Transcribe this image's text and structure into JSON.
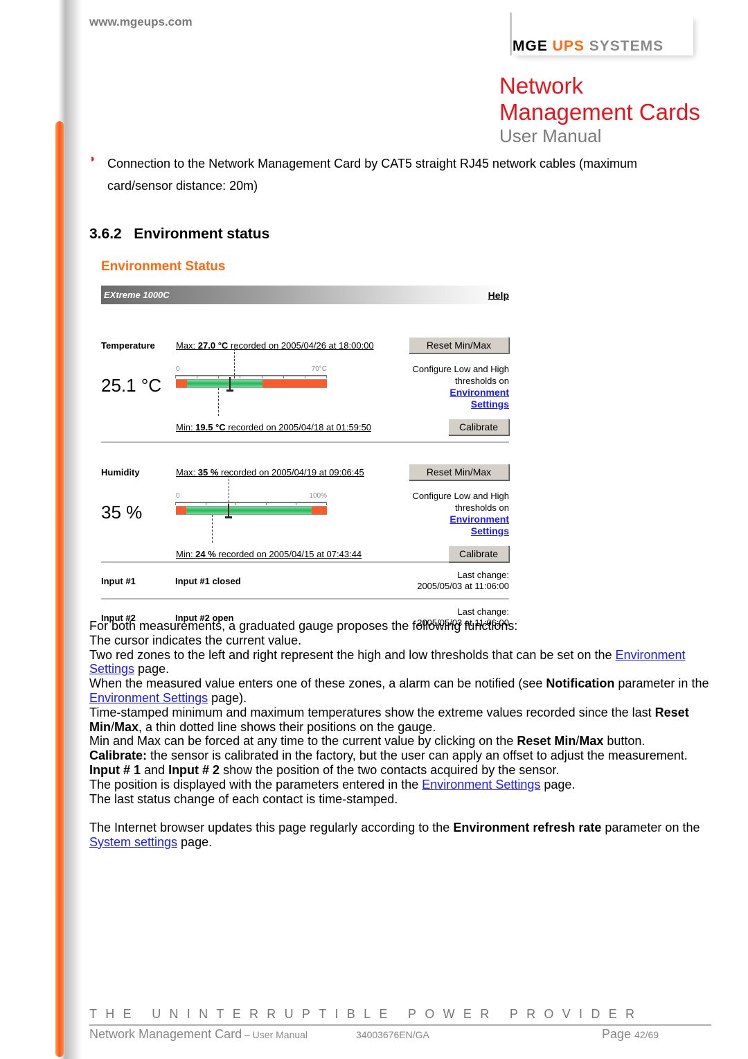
{
  "header": {
    "url": "www.mgeups.com",
    "logo": {
      "mge": "MGE",
      "ups": "UPS",
      "systems": "SYSTEMS"
    },
    "title_line1": "Network",
    "title_line2": "Management Cards",
    "subtitle": "User Manual"
  },
  "bullet": "Connection to the Network Management Card by CAT5 straight RJ45 network cables (maximum card/sensor distance: 20m)",
  "section": {
    "number": "3.6.2",
    "title": "Environment status"
  },
  "panel": {
    "title": "Environment Status",
    "device": "EXtreme 1000C",
    "help": "Help",
    "colors": {
      "zone_red": "#ff5a2a",
      "zone_green": "#33cc66",
      "link": "#1a1aff",
      "accent": "#ff6a10"
    },
    "measurements": [
      {
        "label": "Temperature",
        "value": "25.1 °C",
        "current": 25.1,
        "max_prefix": "Max: ",
        "max_value": "27.0 °C",
        "max_suffix": " recorded on 2005/04/26 at 18:00:00",
        "max": 27.0,
        "min_prefix": "Min: ",
        "min_value": "19.5 °C",
        "min_suffix": " recorded on 2005/04/18 at 01:59:50",
        "min": 19.5,
        "scale_min_label": "0",
        "scale_max_label": "70°C",
        "range": [
          0,
          70
        ],
        "tick_step": 10,
        "low_threshold": 5,
        "high_threshold": 40,
        "reset": "Reset Min/Max",
        "cfg1": "Configure Low and High",
        "cfg2": "thresholds on",
        "link1": "Environment",
        "link2": "Settings",
        "calibrate": "Calibrate"
      },
      {
        "label": "Humidity",
        "value": "35 %",
        "current": 35,
        "max_prefix": "Max: ",
        "max_value": "35 %",
        "max_suffix": " recorded on 2005/04/19 at 09:06:45",
        "max": 35,
        "min_prefix": "Min: ",
        "min_value": "24 %",
        "min_suffix": " recorded on 2005/04/15 at 07:43:44",
        "min": 24,
        "scale_min_label": "0",
        "scale_max_label": "100%",
        "range": [
          0,
          100
        ],
        "tick_step": 20,
        "low_threshold": 7,
        "high_threshold": 90,
        "reset": "Reset Min/Max",
        "cfg1": "Configure Low and High",
        "cfg2": "thresholds on",
        "link1": "Environment",
        "link2": "Settings",
        "calibrate": "Calibrate"
      }
    ],
    "inputs": [
      {
        "label": "Input #1",
        "state": "Input #1 closed",
        "change_label": "Last change:",
        "change_time": "2005/05/03 at 11:06:00"
      },
      {
        "label": "Input #2",
        "state": "Input #2 open",
        "change_label": "Last change:",
        "change_time": "2005/05/03 at 11:06:00"
      }
    ]
  },
  "body": [
    [
      {
        "t": "For both measurements, a graduated gauge proposes the following functions:"
      }
    ],
    [
      {
        "t": "The cursor indicates the current value."
      }
    ],
    [
      {
        "t": "Two red zones to the left and right represent the high and low thresholds that can be set on the "
      },
      {
        "t": "Environment Settings",
        "link": true
      },
      {
        "t": " page."
      }
    ],
    [
      {
        "t": "When the measured value enters one of these zones, a alarm can be notified (see "
      },
      {
        "t": "Notification",
        "b": true
      },
      {
        "t": " parameter in the "
      },
      {
        "t": "Environment Settings",
        "link": true
      },
      {
        "t": " page)."
      }
    ],
    [
      {
        "t": "Time-stamped minimum and maximum temperatures show the extreme values recorded since the last "
      },
      {
        "t": "Reset Min",
        "b": true
      },
      {
        "t": "/"
      },
      {
        "t": "Max",
        "b": true
      },
      {
        "t": ", a thin dotted line shows their positions on the gauge."
      }
    ],
    [
      {
        "t": " Min and Max can be forced at any time to the current value by clicking on the "
      },
      {
        "t": "Reset Min",
        "b": true
      },
      {
        "t": "/"
      },
      {
        "t": "Max",
        "b": true
      },
      {
        "t": " button."
      }
    ],
    [
      {
        "t": "Calibrate:",
        "b": true
      },
      {
        "t": " the sensor is calibrated in the factory, but the user can apply an offset to adjust the measurement."
      }
    ],
    [
      {
        "t": "Input # 1",
        "b": true
      },
      {
        "t": " and "
      },
      {
        "t": "Input # 2",
        "b": true
      },
      {
        "t": " show the position of the two contacts acquired by the sensor."
      }
    ],
    [
      {
        "t": "The position is displayed with the parameters entered in the "
      },
      {
        "t": "Environment Settings",
        "link": true
      },
      {
        "t": " page."
      }
    ],
    [
      {
        "t": "The last status change of each contact is time-stamped."
      }
    ],
    [
      {
        "t": " "
      }
    ],
    [
      {
        "t": "The Internet browser updates this page regularly according to the "
      },
      {
        "t": "Environment refresh rate",
        "b": true
      },
      {
        "t": " parameter on the "
      },
      {
        "t": "System settings",
        "link": true
      },
      {
        "t": " page."
      }
    ]
  ],
  "footer": {
    "slogan": "THE UNINTERRUPTIBLE POWER PROVIDER",
    "doc": "Network Management Card",
    "doc_sub": " – User Manual",
    "ref": "34003676EN/GA",
    "page_label": "Page ",
    "page": "42/69"
  }
}
